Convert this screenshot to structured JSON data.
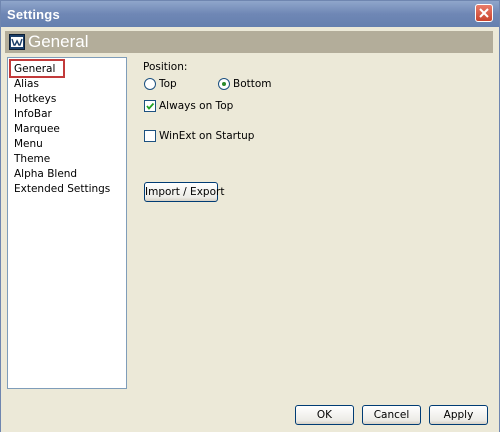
{
  "window": {
    "title": "Settings"
  },
  "header": {
    "icon": "app-logo-icon",
    "title": "General"
  },
  "nav": {
    "selected": "General",
    "items": [
      "General",
      "Alias",
      "Hotkeys",
      "InfoBar",
      "Marquee",
      "Menu",
      "Theme",
      "Alpha Blend",
      "Extended Settings"
    ]
  },
  "general": {
    "position_label": "Position:",
    "position_options": [
      {
        "label": "Top",
        "selected": false
      },
      {
        "label": "Bottom",
        "selected": true
      }
    ],
    "always_on_top": {
      "label": "Always on Top",
      "checked": true
    },
    "winext_on_startup": {
      "label": "WinExt on Startup",
      "checked": false
    },
    "import_export_label": "Import / Export"
  },
  "footer": {
    "ok_label": "OK",
    "cancel_label": "Cancel",
    "apply_label": "Apply"
  },
  "colors": {
    "titlebar": "#6f87b5",
    "header_band": "#b3ad9a",
    "dialog_bg": "#ece9d8",
    "selection_outline": "#c23a3a"
  }
}
